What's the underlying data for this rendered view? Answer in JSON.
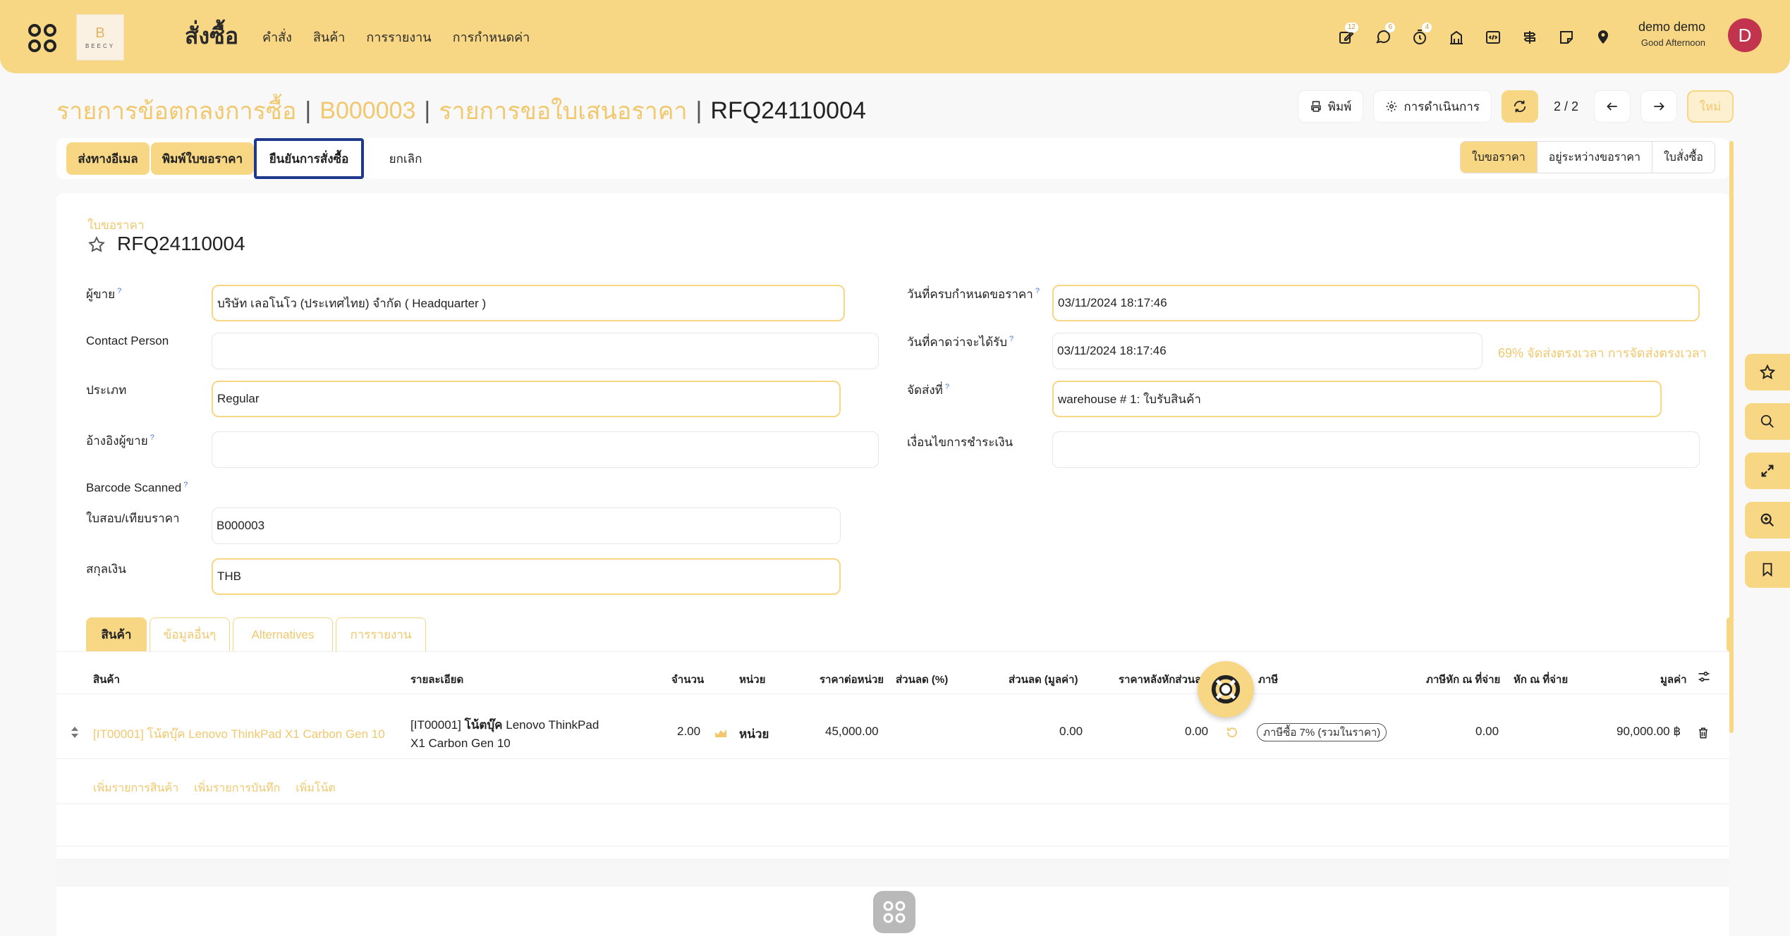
{
  "topbar": {
    "logo_letter": "B",
    "logo_text": "BEECY",
    "app_title": "สั่งซื้อ",
    "nav": [
      "คำสั่ง",
      "สินค้า",
      "การรายงาน",
      "การกำหนดค่า"
    ],
    "badges": {
      "activity": "12",
      "messages": "6",
      "timer": "4"
    },
    "user_name": "demo demo",
    "greeting": "Good Afternoon",
    "avatar_letter": "D"
  },
  "breadcrumb": {
    "items": [
      "รายการข้อตกลงการซื้อ",
      "B000003",
      "รายการขอใบเสนอราคา"
    ],
    "separator": "|",
    "current": "RFQ24110004"
  },
  "controls": {
    "print": "พิมพ์",
    "action": "การดำเนินการ",
    "pager": "2 / 2",
    "new": "ใหม่"
  },
  "actions": {
    "send_email": "ส่งทางอีเมล",
    "print_rfq": "พิมพ์ใบขอราคา",
    "confirm_order": "ยืนยันการสั่งซื้อ",
    "cancel": "ยกเลิก"
  },
  "statusbar": [
    "ใบขอราคา",
    "อยู่ระหว่างขอราคา",
    "ใบสั่งซื้อ"
  ],
  "form": {
    "doc_type": "ใบขอราคา",
    "doc_number": "RFQ24110004",
    "vendor": {
      "label": "ผู้ขาย",
      "value": "บริษัท เลอโนโว (ประเทศไทย) จำกัด  ( Headquarter )"
    },
    "contact": {
      "label": "Contact Person",
      "value": ""
    },
    "type": {
      "label": "ประเภท",
      "value": "Regular"
    },
    "vendor_ref": {
      "label": "อ้างอิงผู้ขาย",
      "value": ""
    },
    "barcode": {
      "label": "Barcode Scanned"
    },
    "agreement": {
      "label": "ใบสอบ/เทียบราคา",
      "value": "B000003"
    },
    "currency": {
      "label": "สกุลเงิน",
      "value": "THB"
    },
    "deadline": {
      "label": "วันที่ครบกำหนดขอราคา",
      "value": "03/11/2024 18:17:46"
    },
    "expected": {
      "label": "วันที่คาดว่าจะได้รับ",
      "value": "03/11/2024 18:17:46"
    },
    "ontime": "69% จัดส่งตรงเวลา การจัดส่งตรงเวลา",
    "deliver_to": {
      "label": "จัดส่งที่",
      "value": "warehouse # 1: ใบรับสินค้า"
    },
    "payment_terms": {
      "label": "เงื่อนไขการชำระเงิน",
      "value": ""
    }
  },
  "tabs": [
    "สินค้า",
    "ข้อมูลอื่นๆ",
    "Alternatives",
    "การรายงาน"
  ],
  "table": {
    "headers": [
      "สินค้า",
      "รายละเอียด",
      "จำนวน",
      "หน่วย",
      "ราคาต่อหน่วย",
      "ส่วนลด (%)",
      "ส่วนลด (มูลค่า)",
      "ราคาหลังหักส่วนลด",
      "ภาษี",
      "ภาษีหัก ณ ที่จ่าย",
      "หัก ณ ที่จ่าย",
      "มูลค่า"
    ],
    "rows": [
      {
        "product": "[IT00001] โน้ตบุ๊ค Lenovo ThinkPad X1 Carbon Gen 10",
        "desc_code": "[IT00001]",
        "desc_bold": "โน้ตบุ๊ค",
        "desc_rest1": "Lenovo ThinkPad",
        "desc_line2": "X1 Carbon Gen 10",
        "qty": "2.00",
        "uom": "หน่วย",
        "price": "45,000.00",
        "disc_pct": "",
        "disc_amt": "0.00",
        "net": "0.00",
        "tax": "ภาษีซื้อ 7% (รวมในราคา)",
        "wht": "0.00",
        "wht2": "",
        "subtotal": "90,000.00 ฿"
      }
    ],
    "add_links": [
      "เพิ่มรายการสินค้า",
      "เพิ่มรายการบันทึก",
      "เพิ่มโน้ต"
    ]
  }
}
